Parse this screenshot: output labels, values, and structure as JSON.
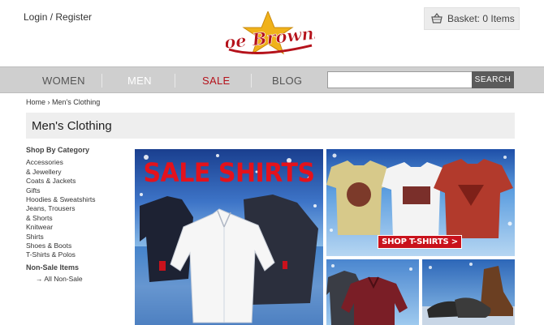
{
  "header": {
    "login_label": "Login / Register",
    "logo_text": "Joe Browns",
    "basket_label": "Basket: 0 Items"
  },
  "nav": {
    "items": [
      {
        "label": "WOMEN"
      },
      {
        "label": "MEN"
      },
      {
        "label": "SALE"
      },
      {
        "label": "BLOG"
      }
    ],
    "search_placeholder": "",
    "search_button": "SEARCH"
  },
  "breadcrumb": {
    "home": "Home",
    "separator": "›",
    "current": "Men's Clothing"
  },
  "page": {
    "title": "Men's Clothing"
  },
  "sidebar": {
    "heading": "Shop By Category",
    "categories": [
      "Accessories & Jewellery",
      "Coats & Jackets",
      "Gifts",
      "Hoodies & Sweatshirts",
      "Jeans, Trousers & Shorts",
      "Knitwear",
      "Shirts",
      "Shoes & Boots",
      "T-Shirts & Polos"
    ],
    "non_sale_heading": "Non-Sale Items",
    "non_sale_link": "→ All Non-Sale"
  },
  "banners": {
    "sale_shirts_headline": "SALE SHIRTS",
    "shop_tshirts_button": "SHOP T-SHIRTS >"
  },
  "colors": {
    "nav_background": "#cfcfcf",
    "sale_red": "#b5121b",
    "search_button": "#5b5b5b",
    "title_bar": "#eeeeee"
  }
}
